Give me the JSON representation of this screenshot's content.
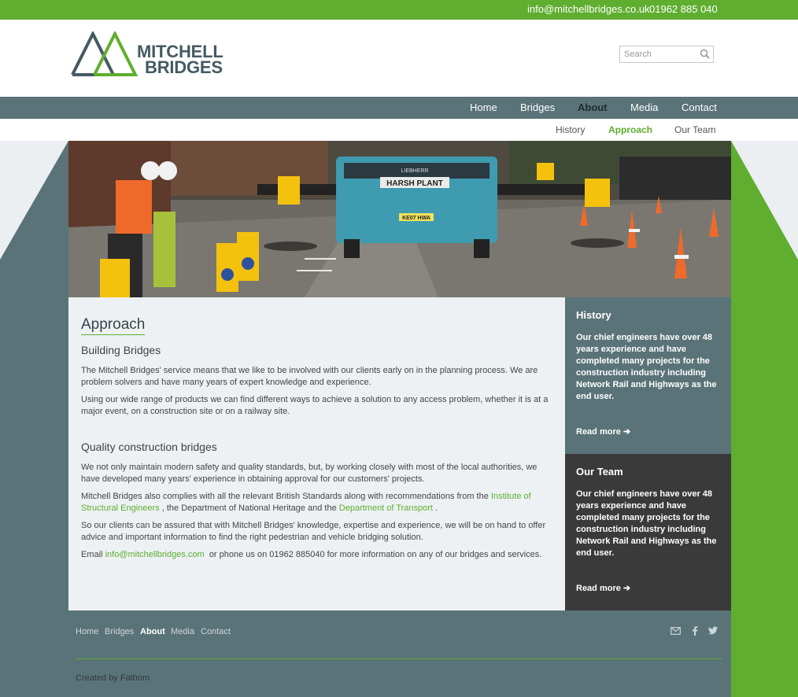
{
  "topbar": {
    "email": "info@mitchellbridges.co.uk",
    "phone": "01962 885 040"
  },
  "logo": {
    "line1": "MITCHELL",
    "line2": "BRIDGES"
  },
  "search": {
    "placeholder": "Search"
  },
  "mainnav": [
    "Home",
    "Bridges",
    "About",
    "Media",
    "Contact"
  ],
  "mainnav_active": "About",
  "subnav": [
    "History",
    "Approach",
    "Our Team"
  ],
  "subnav_active": "Approach",
  "hero": {
    "truck_label": "HARSH PLANT",
    "truck_plate": "KE07 HWA",
    "machine_label": "LIEBHERR"
  },
  "content": {
    "title": "Approach",
    "section1_heading": "Building Bridges",
    "p1": "The Mitchell Bridges' service means that we like to be involved with our clients early on in the planning process. We are problem solvers and have many years of expert knowledge and experience.",
    "p2": "Using our wide range of products we can find different ways to achieve a solution to any access problem, whether it is at a major event, on a construction site or on a railway site.",
    "section2_heading": "Quality construction bridges",
    "p3": "We not only maintain modern safety and quality standards, but, by working closely with most of the local authorities, we have developed many years' experience in obtaining approval for our customers' projects.",
    "p4_pre": "Mitchell Bridges also complies with all the relevant British Standards along with recommendations from the",
    "p4_link1": "Institute of Structural Engineers",
    "p4_mid": ", the Department of National Heritage and the",
    "p4_link2": "Department of Transport",
    "p4_post": ".",
    "p5": "So our clients can be assured that with Mitchell Bridges' knowledge, expertise and experience, we will be on hand to offer advice and important information to find the right pedestrian and vehicle bridging solution.",
    "p6_pre": "Email",
    "p6_link": "info@mitchellbridges.com",
    "p6_post": "or phone us on 01962 885040 for more information on any of our bridges and services."
  },
  "sidebar": [
    {
      "title": "History",
      "text": "Our chief engineers have over 48 years experience and have completed many projects for the construction industry including Network Rail and Highways as the end user.",
      "more": "Read more ➔"
    },
    {
      "title": "Our Team",
      "text": "Our chief engineers have over 48 years experience and have completed many projects for the construction industry including Network Rail and Highways as the end user.",
      "more": "Read more ➔"
    }
  ],
  "footer": {
    "links": [
      "Home",
      "Bridges",
      "About",
      "Media",
      "Contact"
    ],
    "active": "About",
    "icons": [
      "email-icon",
      "facebook-icon",
      "twitter-icon"
    ],
    "credit": "Created by Fathom"
  },
  "colors": {
    "green": "#5fae2f",
    "slate": "#5a7378",
    "dark": "#3a3a3a",
    "light": "#edf1f4"
  }
}
